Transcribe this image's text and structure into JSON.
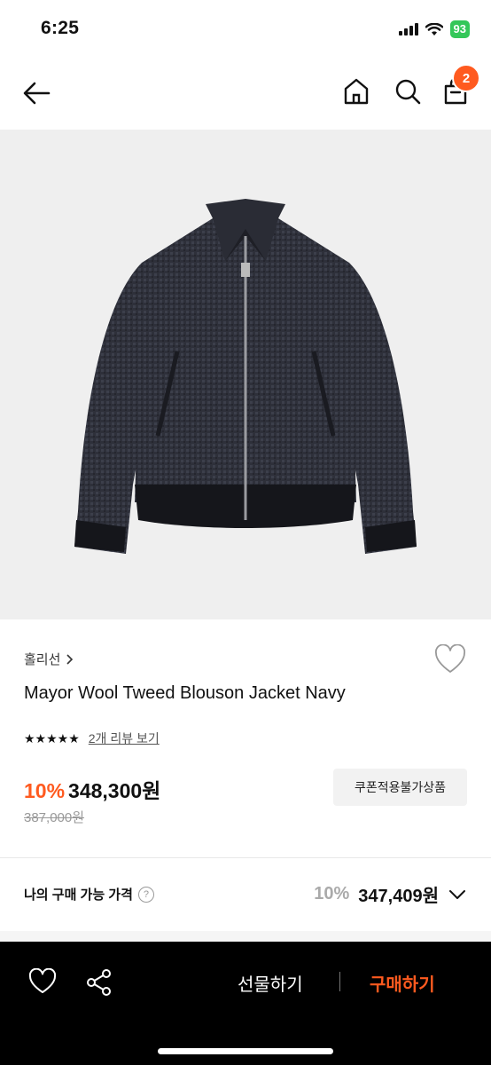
{
  "status_bar": {
    "time": "6:25",
    "battery": "93",
    "icons": [
      "signal-icon",
      "wifi-icon",
      "battery-icon"
    ]
  },
  "nav": {
    "icons": [
      "back-arrow-icon",
      "home-icon",
      "search-icon",
      "cart-icon"
    ],
    "cart_count": "2"
  },
  "product": {
    "image": "navy-wool-tweed-blouson-jacket",
    "brand": "홀리선",
    "name": "Mayor Wool Tweed Blouson Jacket Navy",
    "rating_stars": 5,
    "reviews_link": "2개 리뷰 보기",
    "discount": "10%",
    "price": "348,300원",
    "original_price": "387,000원",
    "coupon_label": "쿠폰적용불가상품"
  },
  "my_price": {
    "label": "나의 구매 가능 가격",
    "help": "?",
    "discount": "10%",
    "amount": "347,409원"
  },
  "bottom_bar": {
    "gift_label": "선물하기",
    "buy_label": "구매하기"
  },
  "colors": {
    "accent": "#ff5a1f",
    "bottom_bar": "#000000",
    "hero_bg": "#efefef",
    "battery": "#34c759"
  }
}
